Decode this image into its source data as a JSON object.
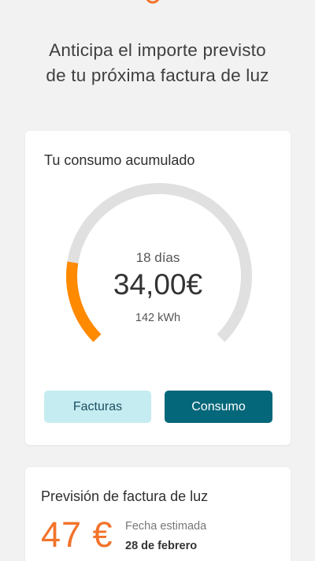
{
  "header": {
    "headline_line1": "Anticipa el importe previsto",
    "headline_line2": "de tu próxima factura de luz"
  },
  "consumo_card": {
    "title": "Tu consumo acumulado",
    "days": "18 días",
    "amount": "34,00€",
    "kwh": "142 kWh",
    "progress_fraction": 0.2,
    "buttons": {
      "facturas": "Facturas",
      "consumo": "Consumo"
    }
  },
  "prevision_card": {
    "title": "Previsión de factura de luz",
    "amount": "47 €",
    "date_label": "Fecha estimada",
    "date_value": "28 de febrero"
  },
  "colors": {
    "accent_orange": "#ff8a00",
    "forecast_orange": "#f2732a",
    "track_gray": "#e0e0e0",
    "primary_teal": "#05677a",
    "secondary_light_blue": "#c5ecf1"
  },
  "icons": {
    "brand": "brand-logo-icon"
  }
}
